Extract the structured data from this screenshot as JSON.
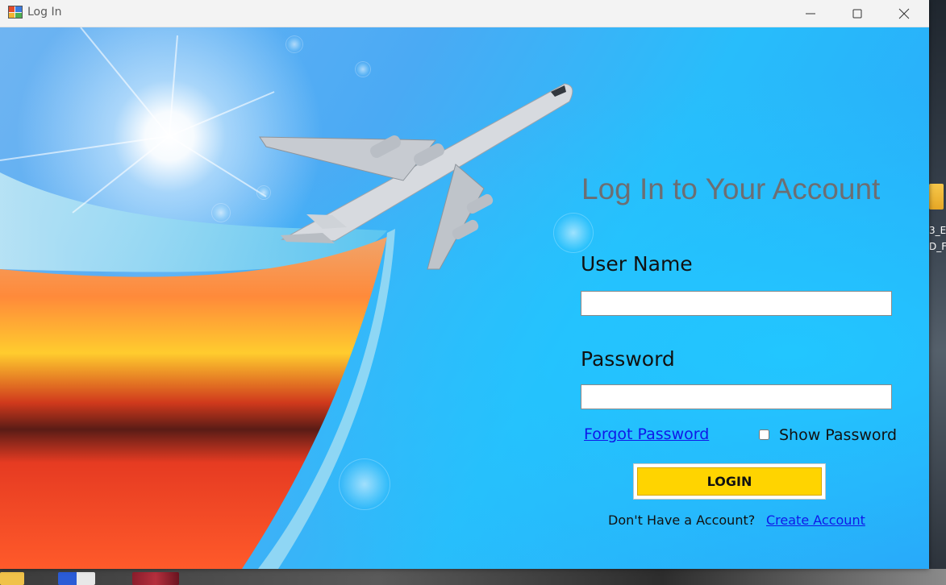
{
  "window": {
    "title": "Log In",
    "icon": "winforms-app-icon",
    "controls": [
      "minimize-icon",
      "maximize-icon",
      "close-icon"
    ]
  },
  "form": {
    "heading": "Log In to Your Account",
    "username_label": "User Name",
    "username_value": "",
    "password_label": "Password",
    "password_value": "",
    "forgot_link": "Forgot Password",
    "show_password_label": "Show Password",
    "show_password_checked": false,
    "login_button": "LOGIN",
    "no_account_text": "Don't Have a Account?",
    "create_account_link": "Create Account"
  },
  "desktop": {
    "text_1": "3_E",
    "text_2": "D_F"
  },
  "colors": {
    "heading": "#6d6e72",
    "link": "#0f18e8",
    "login_button": "#ffd400",
    "background_blue": "#28bdfb"
  }
}
